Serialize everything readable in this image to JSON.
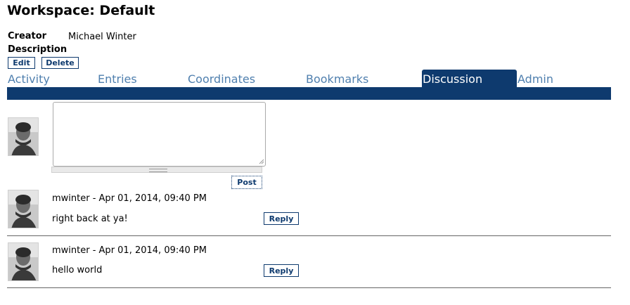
{
  "page": {
    "title": "Workspace: Default"
  },
  "info": {
    "creator_label": "Creator",
    "creator_value": "Michael Winter",
    "description_label": "Description"
  },
  "actions": {
    "edit_label": "Edit",
    "delete_label": "Delete"
  },
  "tabs": [
    {
      "label": "Activity",
      "active": false
    },
    {
      "label": "Entries",
      "active": false
    },
    {
      "label": "Coordinates",
      "active": false
    },
    {
      "label": "Bookmarks",
      "active": false
    },
    {
      "label": "Discussion",
      "active": true
    },
    {
      "label": "Admin",
      "active": false
    }
  ],
  "composer": {
    "value": "",
    "post_label": "Post"
  },
  "posts": [
    {
      "author_line": "mwinter - Apr 01, 2014, 09:40 PM",
      "text": "right back at ya!",
      "reply_label": "Reply"
    },
    {
      "author_line": "mwinter - Apr 01, 2014, 09:40 PM",
      "text": "hello world",
      "reply_label": "Reply"
    }
  ],
  "colors": {
    "accent": "#0e3a6e",
    "tab_text": "#4f7fae"
  },
  "icons": {
    "avatar": "user-avatar-photo",
    "resize": "resize-grip-icon"
  }
}
